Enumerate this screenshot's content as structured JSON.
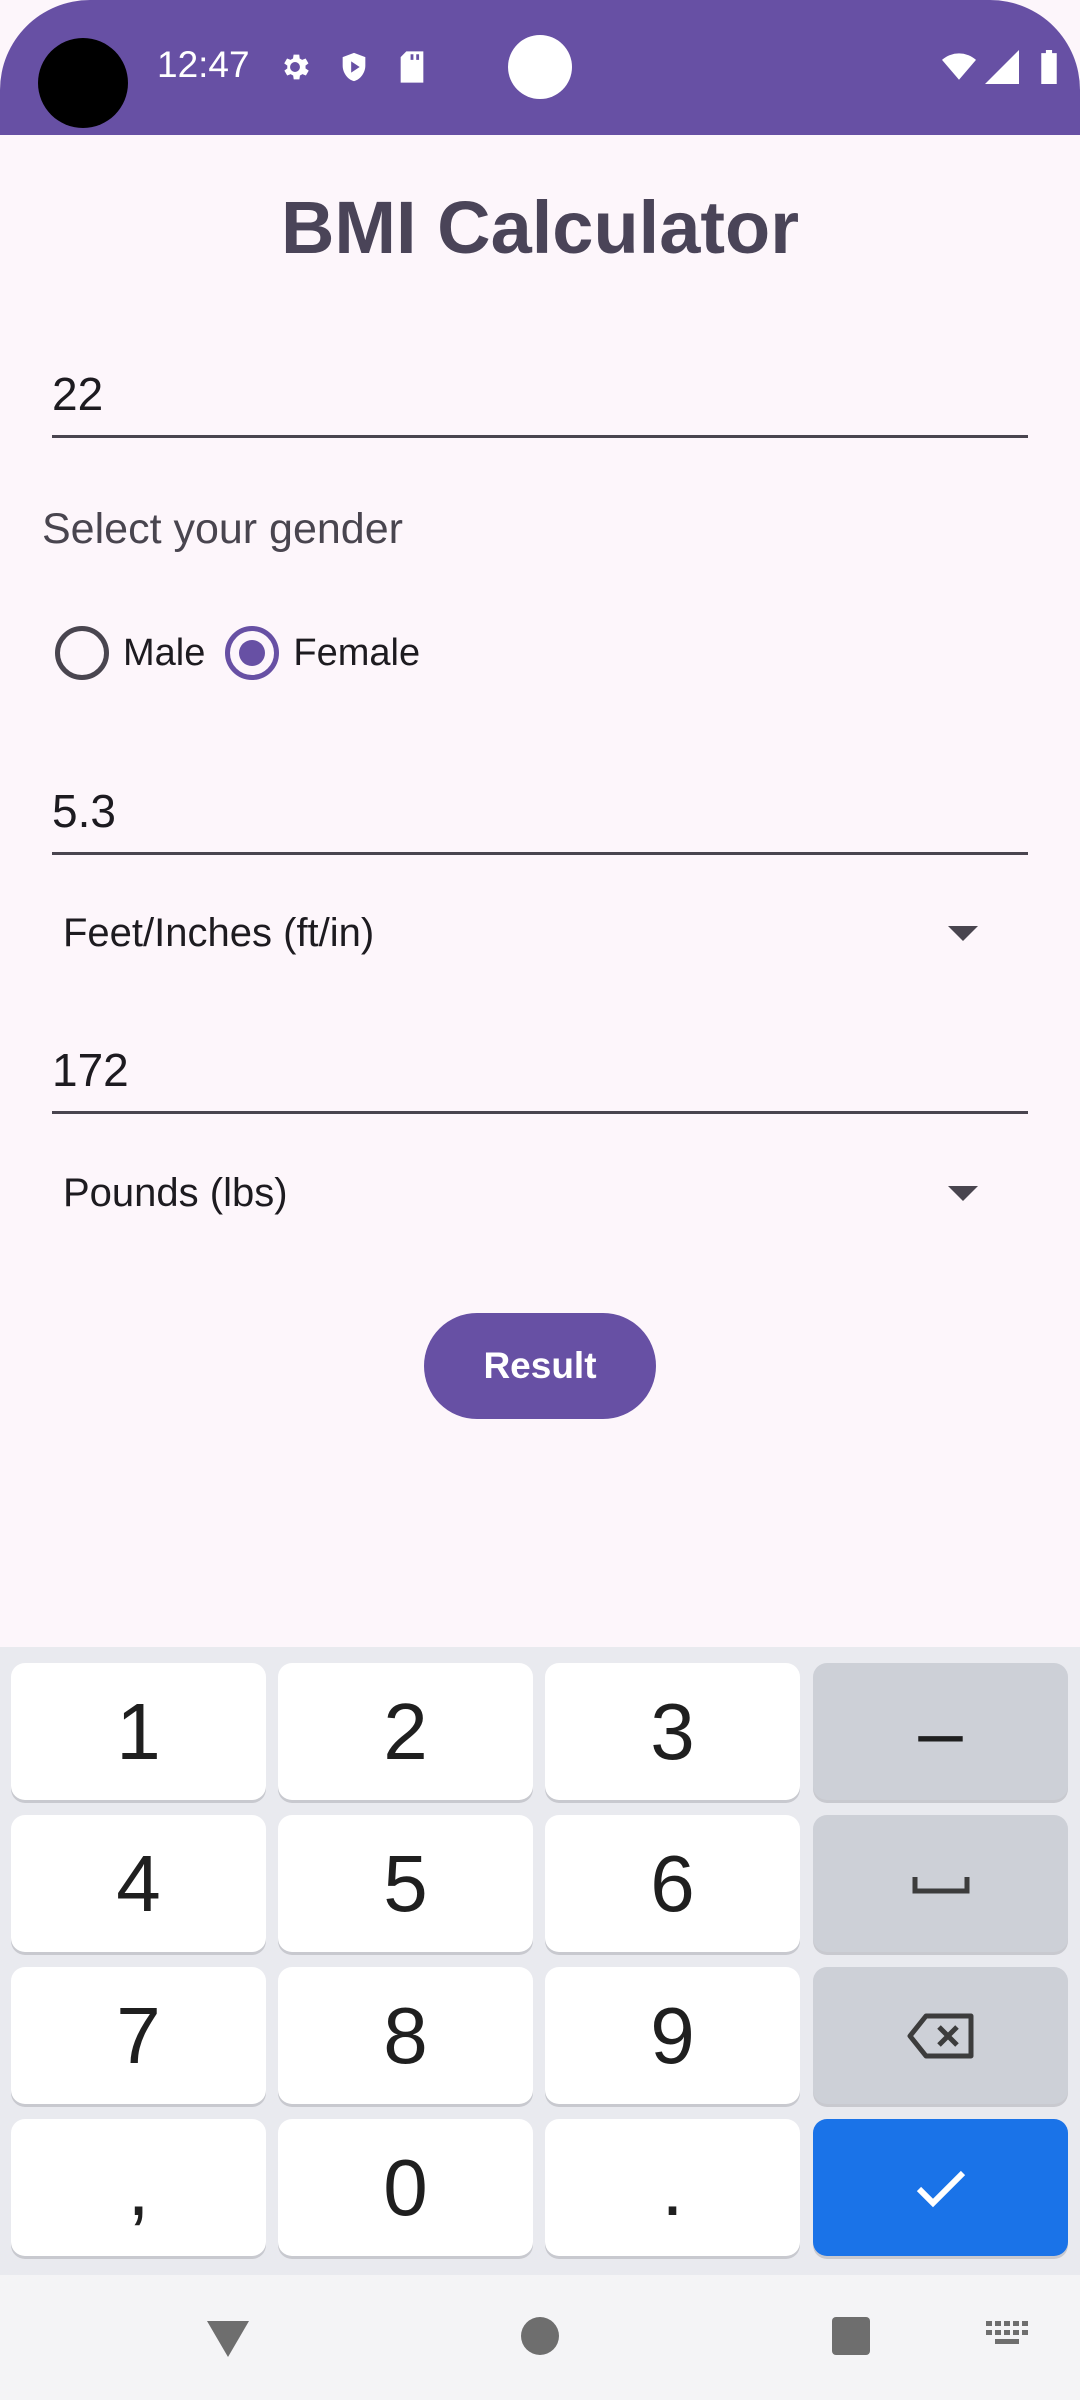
{
  "status_bar": {
    "time": "12:47",
    "icons": [
      "settings-icon",
      "shield-play-icon",
      "sd-card-icon",
      "wifi-icon",
      "signal-icon",
      "battery-icon"
    ]
  },
  "app": {
    "title": "BMI Calculator",
    "age_value": "22",
    "gender_label": "Select your gender",
    "gender_options": [
      {
        "label": "Male",
        "selected": false
      },
      {
        "label": "Female",
        "selected": true
      }
    ],
    "height_value": "5.3",
    "height_unit": "Feet/Inches (ft/in)",
    "weight_value": "172",
    "weight_unit": "Pounds (lbs)",
    "result_label": "Result"
  },
  "keyboard": {
    "rows": [
      [
        "1",
        "2",
        "3",
        "–"
      ],
      [
        "4",
        "5",
        "6",
        "space"
      ],
      [
        "7",
        "8",
        "9",
        "backspace"
      ],
      [
        ",",
        "0",
        ".",
        "done"
      ]
    ]
  },
  "colors": {
    "primary": "#6750a4",
    "background": "#fdf6fb",
    "enter_key": "#1a73e8"
  }
}
